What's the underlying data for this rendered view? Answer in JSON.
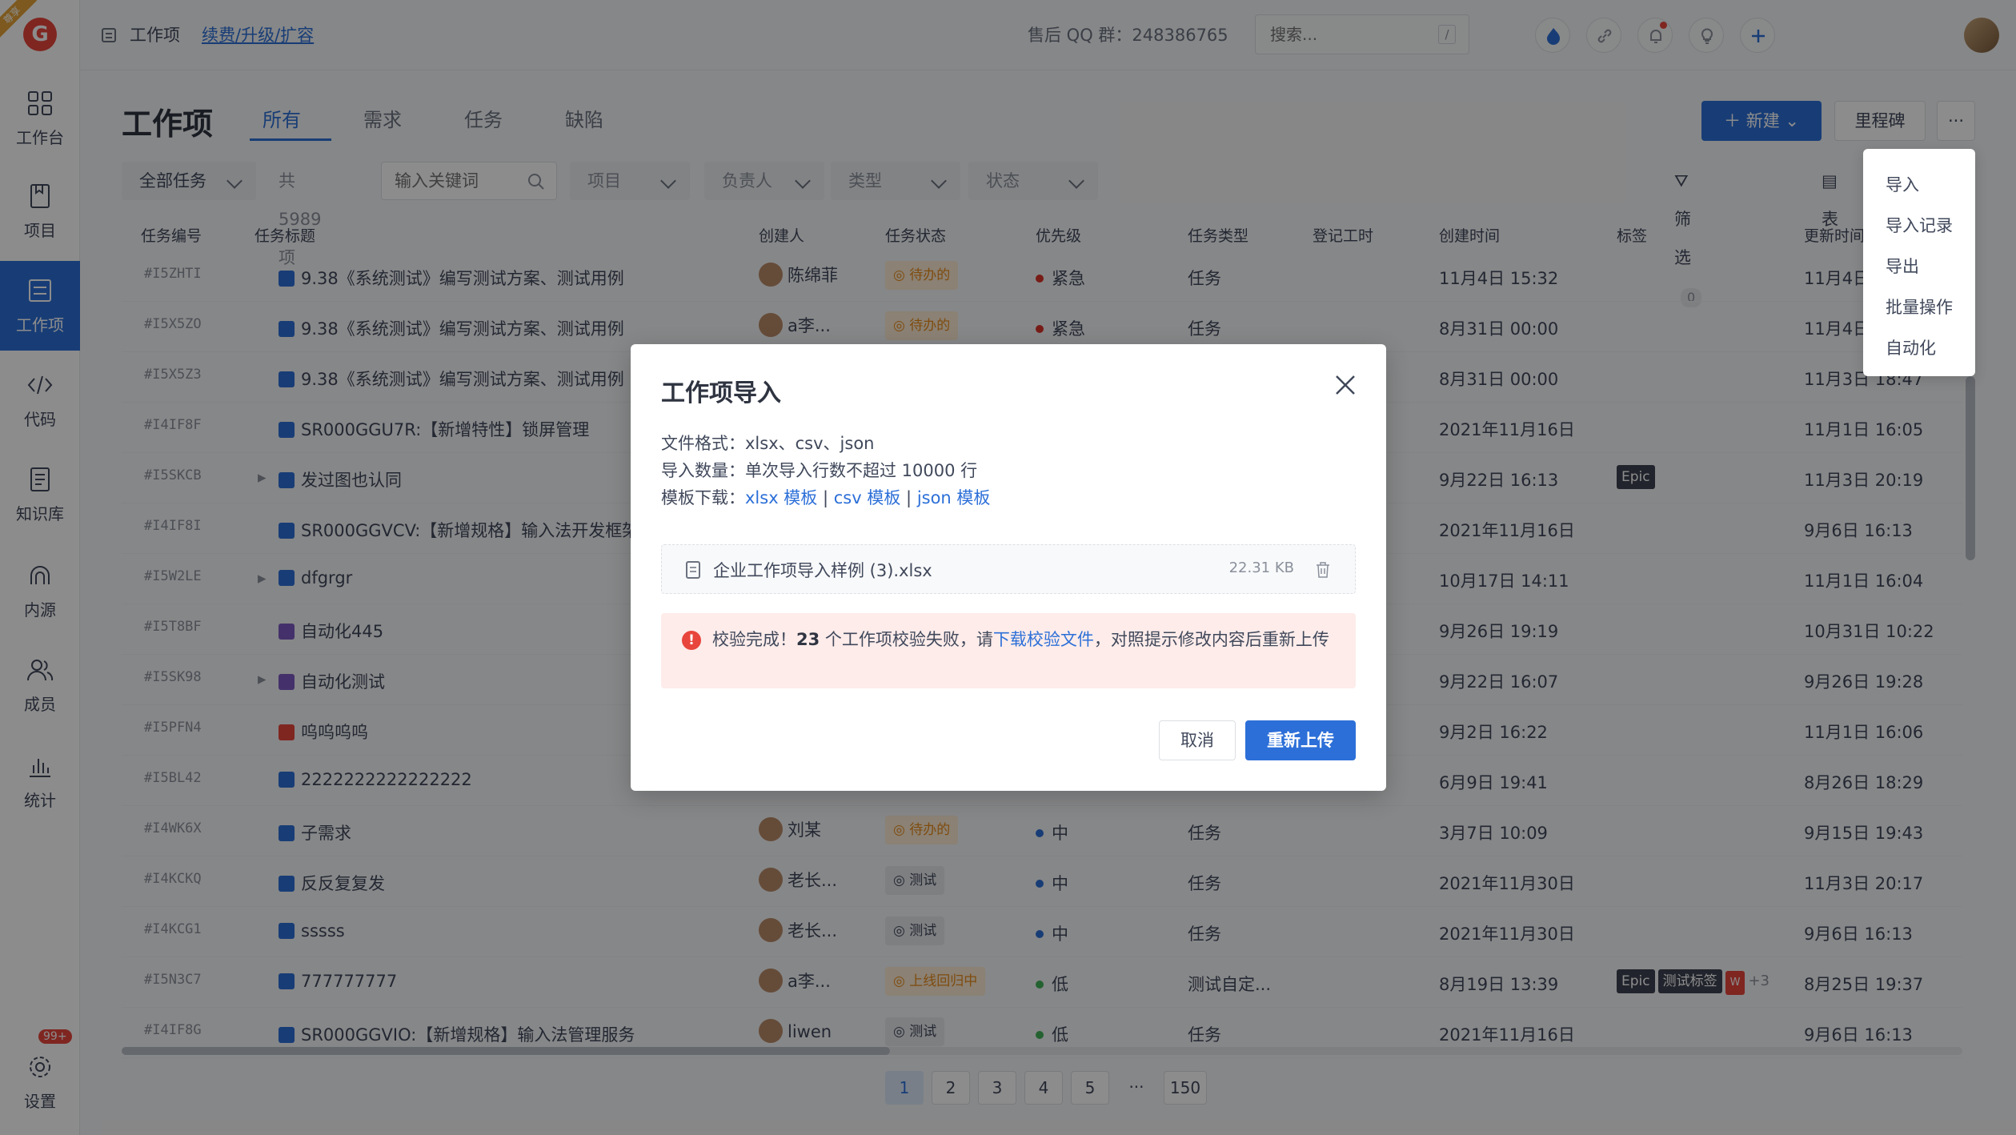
{
  "ribbon": "尊享",
  "logo": "G",
  "nav": [
    {
      "label": "工作台"
    },
    {
      "label": "项目"
    },
    {
      "label": "工作项"
    },
    {
      "label": "代码"
    },
    {
      "label": "知识库"
    },
    {
      "label": "内源"
    },
    {
      "label": "成员"
    },
    {
      "label": "统计"
    },
    {
      "label": "设置"
    }
  ],
  "settings_badge": "99+",
  "header": {
    "breadcrumb": "工作项",
    "renew_link": "续费/升级/扩容",
    "qq": "售后 QQ 群：248386765",
    "search_placeholder": "搜索...",
    "search_shortcut": "/"
  },
  "page": {
    "title": "工作项",
    "tabs": [
      "所有",
      "需求",
      "任务",
      "缺陷"
    ],
    "new_button": "新建",
    "milestone_button": "里程碑",
    "more_button": "···"
  },
  "filters": {
    "scope": "全部任务",
    "count": "共 5989 项",
    "keyword_placeholder": "输入关键词",
    "project": "项目",
    "assignee": "负责人",
    "type": "类型",
    "status": "状态",
    "filter": "筛选",
    "filter_count": "0",
    "table_view": "表"
  },
  "columns": [
    "任务编号",
    "任务标题",
    "创建人",
    "任务状态",
    "优先级",
    "任务类型",
    "登记工时",
    "创建时间",
    "标签",
    "更新时间"
  ],
  "rows": [
    {
      "id": "#I5ZHTI",
      "title": "9.38《系统测试》编写测试方案、测试用例",
      "creator": "陈绵菲",
      "status": "待办的",
      "priority": "紧急",
      "type": "任务",
      "created": "11月4日 15:32",
      "tags": [],
      "updated": "11月4日"
    },
    {
      "id": "#I5X5ZO",
      "title": "9.38《系统测试》编写测试方案、测试用例",
      "creator": "a李...",
      "status": "待办的",
      "priority": "紧急",
      "type": "任务",
      "created": "8月31日 00:00",
      "tags": [],
      "updated": "11月4日"
    },
    {
      "id": "#I5X5Z3",
      "title": "9.38《系统测试》编写测试方案、测试用例",
      "creator": "",
      "status": "",
      "priority": "",
      "type": "",
      "created": "8月31日 00:00",
      "tags": [],
      "updated": "11月3日 18:47"
    },
    {
      "id": "#I4IF8F",
      "title": "SR000GGU7R:【新增特性】锁屏管理",
      "creator": "",
      "status": "",
      "priority": "",
      "type": "",
      "created": "2021年11月16日",
      "tags": [],
      "updated": "11月1日 16:05"
    },
    {
      "id": "#I5SKCB",
      "title": "发过图也认同",
      "creator": "",
      "status": "",
      "priority": "",
      "type": "",
      "created": "9月22日 16:13",
      "tags": [
        "Epic"
      ],
      "updated": "11月3日 20:19"
    },
    {
      "id": "#I4IF8I",
      "title": "SR000GGVCV:【新增规格】输入法开发框架",
      "creator": "",
      "status": "",
      "priority": "",
      "type": "",
      "created": "2021年11月16日",
      "tags": [],
      "updated": "9月6日 16:13"
    },
    {
      "id": "#I5W2LE",
      "title": "dfgrgr",
      "creator": "",
      "status": "",
      "priority": "",
      "type": "",
      "created": "10月17日 14:11",
      "tags": [],
      "updated": "11月1日 16:04"
    },
    {
      "id": "#I5T8BF",
      "title": "自动化445",
      "creator": "",
      "status": "",
      "priority": "",
      "type": "",
      "created": "9月26日 19:19",
      "tags": [],
      "updated": "10月31日 10:22"
    },
    {
      "id": "#I5SK98",
      "title": "自动化测试",
      "creator": "",
      "status": "",
      "priority": "",
      "type": "",
      "created": "9月22日 16:07",
      "tags": [],
      "updated": "9月26日 19:28"
    },
    {
      "id": "#I5PFN4",
      "title": "呜呜呜呜",
      "creator": "",
      "status": "",
      "priority": "",
      "type": "",
      "created": "9月2日 16:22",
      "tags": [],
      "updated": "11月1日 16:06"
    },
    {
      "id": "#I5BL42",
      "title": "2222222222222222",
      "creator": "",
      "status": "",
      "priority": "",
      "type": "",
      "created": "6月9日 19:41",
      "tags": [],
      "updated": "8月26日 18:29"
    },
    {
      "id": "#I4WK6X",
      "title": "子需求",
      "creator": "刘某",
      "status": "待办的",
      "priority": "中",
      "type": "任务",
      "created": "3月7日 10:09",
      "tags": [],
      "updated": "9月15日 19:43"
    },
    {
      "id": "#I4KCKQ",
      "title": "反反复复发",
      "creator": "老长...",
      "status": "测试",
      "priority": "中",
      "type": "任务",
      "created": "2021年11月30日",
      "tags": [],
      "updated": "11月3日 20:17"
    },
    {
      "id": "#I4KCG1",
      "title": "sssss",
      "creator": "老长...",
      "status": "测试",
      "priority": "中",
      "type": "任务",
      "created": "2021年11月30日",
      "tags": [],
      "updated": "9月6日 16:13"
    },
    {
      "id": "#I5N3C7",
      "title": "777777777",
      "creator": "a李...",
      "status": "上线回归中",
      "priority": "低",
      "type": "测试自定...",
      "created": "8月19日 13:39",
      "tags": [
        "Epic",
        "测试标签",
        "W",
        "+3"
      ],
      "updated": "8月25日 19:37"
    },
    {
      "id": "#I4IF8G",
      "title": "SR000GGVIO:【新增规格】输入法管理服务",
      "creator": "liwen",
      "status": "测试",
      "priority": "低",
      "type": "任务",
      "created": "2021年11月16日",
      "tags": [],
      "updated": "9月6日 16:13"
    }
  ],
  "pagination": [
    "1",
    "2",
    "3",
    "4",
    "5",
    "···",
    "150"
  ],
  "dropdown": [
    "导入",
    "导入记录",
    "导出",
    "批量操作",
    "自动化"
  ],
  "modal": {
    "title": "工作项导入",
    "format_line": "文件格式：xlsx、csv、json",
    "count_line": "导入数量：单次导入行数不超过 10000 行",
    "template_label": "模板下载：",
    "template_xlsx": "xlsx 模板",
    "template_csv": "csv 模板",
    "template_json": "json 模板",
    "sep": "|",
    "file_name": "企业工作项导入样例 (3).xlsx",
    "file_size": "22.31 KB",
    "alert_prefix": "校验完成！",
    "alert_count": "23",
    "alert_mid": " 个工作项校验失败，请",
    "alert_link": "下载校验文件",
    "alert_suffix": "，对照提示修改内容后重新上传",
    "cancel": "取消",
    "reupload": "重新上传"
  },
  "colors": {
    "primary": "#2c6fd8",
    "danger": "#e8453c",
    "todo": "#e88a1a",
    "priority_urgent": "#d9342b",
    "priority_mid": "#2c6fd8",
    "priority_low": "#43b35a"
  }
}
